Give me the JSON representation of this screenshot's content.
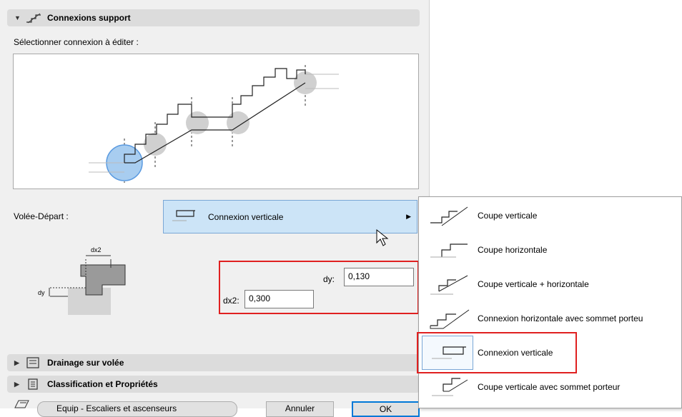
{
  "section_support": {
    "title": "Connexions support"
  },
  "select_label": "Sélectionner connexion à éditer :",
  "flight_start": {
    "label": "Volée-Départ :",
    "value": "Connexion verticale"
  },
  "params": {
    "dy_label": "dy:",
    "dy_value": "0,130",
    "dx2_label": "dx2:",
    "dx2_value": "0,300",
    "diagram_dx2": "dx2",
    "diagram_dy": "dy"
  },
  "sections": [
    {
      "title": "Drainage sur volée"
    },
    {
      "title": "Classification et Propriétés"
    }
  ],
  "footer": {
    "layer": "Equip - Escaliers et ascenseurs",
    "cancel": "Annuler",
    "ok": "OK"
  },
  "menu": {
    "items": [
      {
        "label": "Coupe verticale"
      },
      {
        "label": "Coupe horizontale"
      },
      {
        "label": "Coupe verticale + horizontale"
      },
      {
        "label": "Connexion horizontale avec sommet porteu"
      },
      {
        "label": "Connexion verticale",
        "selected": true
      },
      {
        "label": "Coupe verticale avec sommet porteur"
      }
    ]
  },
  "colors": {
    "highlight": "#cce4f7",
    "annotation": "#e02020"
  }
}
